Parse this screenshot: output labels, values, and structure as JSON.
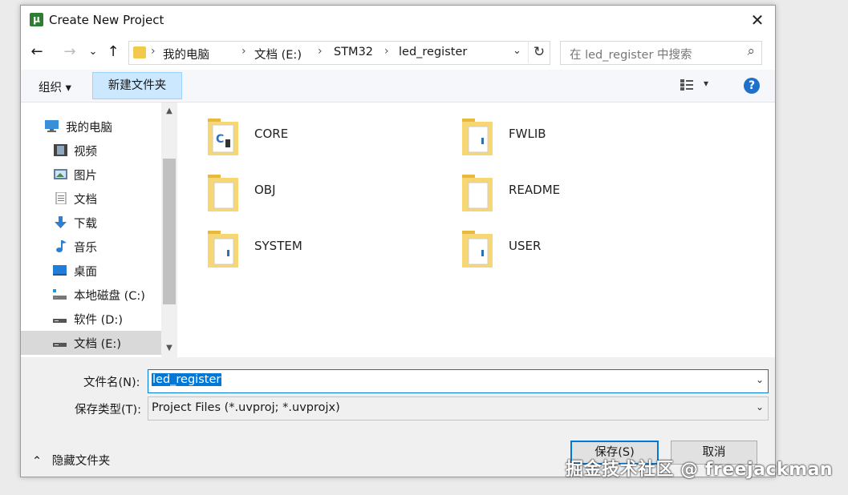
{
  "window": {
    "title": "Create New Project",
    "app_icon": "µ",
    "close": "✕"
  },
  "nav": {
    "back": "←",
    "forward": "→",
    "recent": "⌄",
    "up": "↑",
    "breadcrumbs": [
      "我的电脑",
      "文档 (E:)",
      "STM32",
      "led_register"
    ],
    "separator": "›",
    "dropdown": "⌄",
    "refresh": "↻",
    "search_placeholder": "在 led_register 中搜索",
    "search_icon": "⌕"
  },
  "toolbar": {
    "organize": "组织 ▾",
    "new_folder": "新建文件夹",
    "view_dropdown": "▾",
    "help": "?"
  },
  "sidebar": {
    "items": [
      {
        "label": "我的电脑",
        "icon": "computer-icon"
      },
      {
        "label": "视频",
        "icon": "video-icon"
      },
      {
        "label": "图片",
        "icon": "pictures-icon"
      },
      {
        "label": "文档",
        "icon": "documents-icon"
      },
      {
        "label": "下载",
        "icon": "download-icon"
      },
      {
        "label": "音乐",
        "icon": "music-icon"
      },
      {
        "label": "桌面",
        "icon": "desktop-icon"
      },
      {
        "label": "本地磁盘 (C:)",
        "icon": "drive-c-icon"
      },
      {
        "label": "软件 (D:)",
        "icon": "drive-icon"
      },
      {
        "label": "文档 (E:)",
        "icon": "drive-icon",
        "selected": true
      }
    ],
    "scroll_up": "▲",
    "scroll_down": "▼"
  },
  "folders": [
    {
      "name": "CORE"
    },
    {
      "name": "FWLIB"
    },
    {
      "name": "OBJ"
    },
    {
      "name": "README"
    },
    {
      "name": "SYSTEM"
    },
    {
      "name": "USER"
    }
  ],
  "form": {
    "filename_label": "文件名(N):",
    "filename_value": "led_register",
    "filetype_label": "保存类型(T):",
    "filetype_value": "Project Files (*.uvproj; *.uvprojx)",
    "dropdown": "⌄"
  },
  "footer": {
    "hide_folders": "隐藏文件夹",
    "hide_arrow": "⌃",
    "save": "保存(S)",
    "cancel": "取消"
  },
  "watermark": "掘金技术社区 @ freejackman",
  "colors": {
    "accent": "#0078d7",
    "new_folder_bg": "#cce8ff",
    "folder": "#f2c94c",
    "help": "#1e70c8"
  }
}
